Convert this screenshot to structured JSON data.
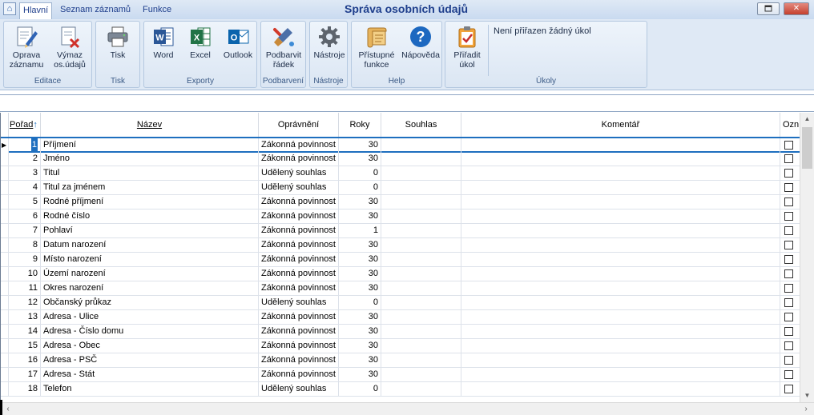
{
  "window": {
    "title": "Správa osobních údajů"
  },
  "tabs": [
    {
      "label": "Hlavní",
      "active": true
    },
    {
      "label": "Seznam záznamů",
      "active": false
    },
    {
      "label": "Funkce",
      "active": false
    }
  ],
  "ribbon": {
    "editace": {
      "label": "Editace",
      "oprava": "Oprava\nzáznamu",
      "vymaz": "Výmaz\nos.údajů"
    },
    "tisk": {
      "label": "Tisk",
      "tisk": "Tisk"
    },
    "exporty": {
      "label": "Exporty",
      "word": "Word",
      "excel": "Excel",
      "outlook": "Outlook"
    },
    "podbarveni": {
      "label": "Podbarvení",
      "podbarvit": "Podbarvit\nřádek"
    },
    "nastroje": {
      "label": "Nástroje",
      "nastroje": "Nástroje"
    },
    "help": {
      "label": "Help",
      "pristupne": "Přístupné\nfunkce",
      "napoveda": "Nápověda"
    },
    "ukoly": {
      "label": "Úkoly",
      "priradit": "Přiřadit\núkol",
      "status": "Není přiřazen žádný úkol"
    }
  },
  "grid": {
    "columns": {
      "poradi": "Pořad",
      "nazev": "Název",
      "opravneni": "Oprávnění",
      "roky": "Roky",
      "souhlas": "Souhlas",
      "komentar": "Komentář",
      "ozn": "Ozn"
    },
    "rows": [
      {
        "poradi": "1",
        "nazev": "Příjmení",
        "opravneni": "Zákonná povinnost",
        "roky": "30"
      },
      {
        "poradi": "2",
        "nazev": "Jméno",
        "opravneni": "Zákonná povinnost",
        "roky": "30"
      },
      {
        "poradi": "3",
        "nazev": "Titul",
        "opravneni": "Udělený souhlas",
        "roky": "0"
      },
      {
        "poradi": "4",
        "nazev": "Titul za jménem",
        "opravneni": "Udělený souhlas",
        "roky": "0"
      },
      {
        "poradi": "5",
        "nazev": "Rodné příjmení",
        "opravneni": "Zákonná povinnost",
        "roky": "30"
      },
      {
        "poradi": "6",
        "nazev": "Rodné číslo",
        "opravneni": "Zákonná povinnost",
        "roky": "30"
      },
      {
        "poradi": "7",
        "nazev": "Pohlaví",
        "opravneni": "Zákonná povinnost",
        "roky": "1"
      },
      {
        "poradi": "8",
        "nazev": "Datum narození",
        "opravneni": "Zákonná povinnost",
        "roky": "30"
      },
      {
        "poradi": "9",
        "nazev": "Místo narození",
        "opravneni": "Zákonná povinnost",
        "roky": "30"
      },
      {
        "poradi": "10",
        "nazev": "Území narození",
        "opravneni": "Zákonná povinnost",
        "roky": "30"
      },
      {
        "poradi": "11",
        "nazev": "Okres narození",
        "opravneni": "Zákonná povinnost",
        "roky": "30"
      },
      {
        "poradi": "12",
        "nazev": "Občanský průkaz",
        "opravneni": "Udělený souhlas",
        "roky": "0"
      },
      {
        "poradi": "13",
        "nazev": "Adresa - Ulice",
        "opravneni": "Zákonná povinnost",
        "roky": "30"
      },
      {
        "poradi": "14",
        "nazev": "Adresa - Číslo domu",
        "opravneni": "Zákonná povinnost",
        "roky": "30"
      },
      {
        "poradi": "15",
        "nazev": "Adresa - Obec",
        "opravneni": "Zákonná povinnost",
        "roky": "30"
      },
      {
        "poradi": "16",
        "nazev": "Adresa - PSČ",
        "opravneni": "Zákonná povinnost",
        "roky": "30"
      },
      {
        "poradi": "17",
        "nazev": "Adresa - Stát",
        "opravneni": "Zákonná povinnost",
        "roky": "30"
      },
      {
        "poradi": "18",
        "nazev": "Telefon",
        "opravneni": "Udělený souhlas",
        "roky": "0"
      }
    ]
  },
  "colors": {
    "accent": "#1e6fbf",
    "title": "#1e3e8c"
  },
  "icons": [
    "home-icon",
    "edit-icon",
    "delete-icon",
    "printer-icon",
    "word-icon",
    "excel-icon",
    "outlook-icon",
    "paint-icon",
    "gear-icon",
    "scroll-icon",
    "help-icon",
    "clipboard-check-icon"
  ]
}
